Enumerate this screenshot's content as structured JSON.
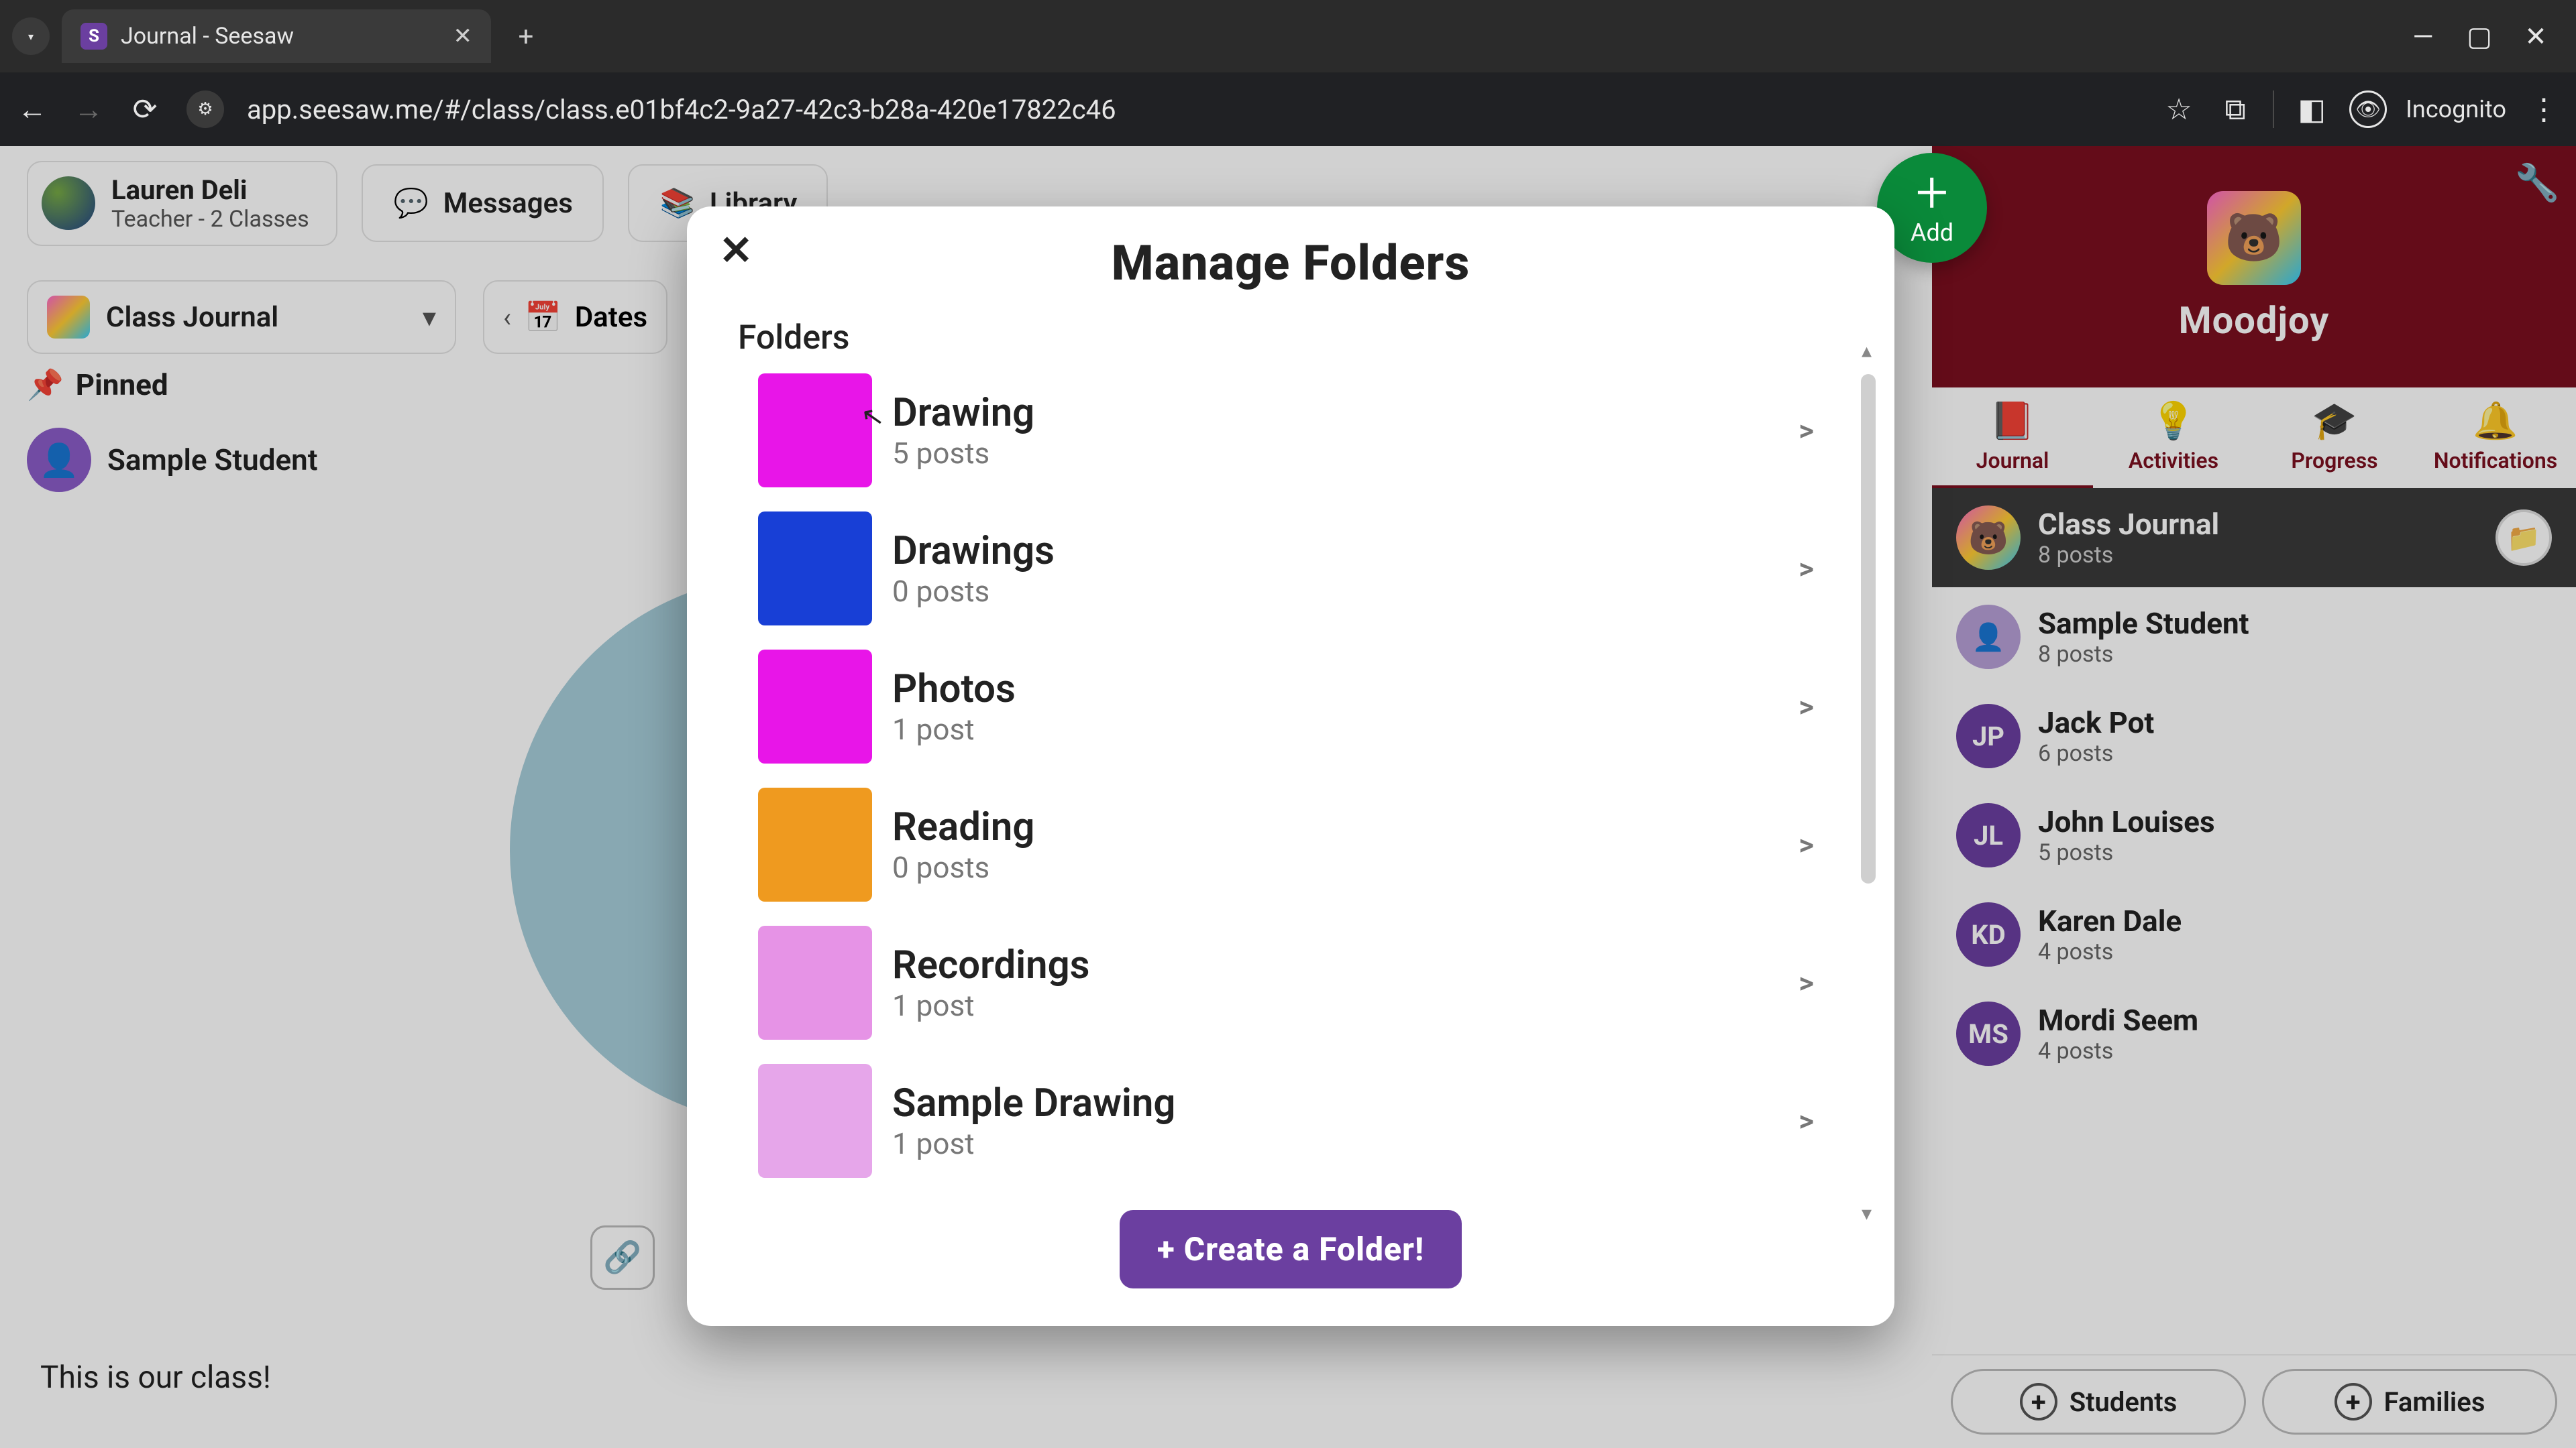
{
  "browser": {
    "tab_title": "Journal - Seesaw",
    "favicon_letter": "S",
    "url": "app.seesaw.me/#/class/class.e01bf4c2-9a27-42c3-b28a-420e17822c46",
    "incognito_label": "Incognito"
  },
  "header": {
    "user_name": "Lauren Deli",
    "user_role": "Teacher - 2 Classes",
    "tab_messages": "Messages",
    "tab_library": "Library"
  },
  "add_fab": {
    "label": "Add"
  },
  "class_panel": {
    "class_name": "Moodjoy",
    "tabs": {
      "journal": "Journal",
      "activities": "Activities",
      "progress": "Progress",
      "notifications": "Notifications"
    },
    "rows": [
      {
        "avatar": "img",
        "initials": "",
        "name": "Class Journal",
        "sub": "8 posts",
        "selected": true,
        "has_folder_badge": true
      },
      {
        "avatar": "grey",
        "initials": "",
        "name": "Sample Student",
        "sub": "8 posts"
      },
      {
        "avatar": "purple",
        "initials": "JP",
        "name": "Jack Pot",
        "sub": "6 posts"
      },
      {
        "avatar": "purple",
        "initials": "JL",
        "name": "John Louises",
        "sub": "5 posts"
      },
      {
        "avatar": "purple",
        "initials": "KD",
        "name": "Karen Dale",
        "sub": "4 posts"
      },
      {
        "avatar": "purple",
        "initials": "MS",
        "name": "Mordi Seem",
        "sub": "4 posts"
      }
    ],
    "bottom": {
      "students": "Students",
      "families": "Families"
    }
  },
  "left": {
    "class_journal": "Class Journal",
    "dates": "Dates",
    "pinned": "Pinned",
    "sample_student": "Sample Student",
    "caption": "This is our class!"
  },
  "modal": {
    "title": "Manage Folders",
    "section": "Folders",
    "folders": [
      {
        "name": "Drawing",
        "meta": "5 posts",
        "color": "c-magenta"
      },
      {
        "name": "Drawings",
        "meta": "0 posts",
        "color": "c-blue"
      },
      {
        "name": "Photos",
        "meta": "1 post",
        "color": "c-magenta"
      },
      {
        "name": "Reading",
        "meta": "0 posts",
        "color": "c-orange"
      },
      {
        "name": "Recordings",
        "meta": "1 post",
        "color": "c-pink"
      },
      {
        "name": "Sample Drawing",
        "meta": "1 post",
        "color": "c-lightpink"
      }
    ],
    "create_label": "+ Create a Folder!"
  }
}
